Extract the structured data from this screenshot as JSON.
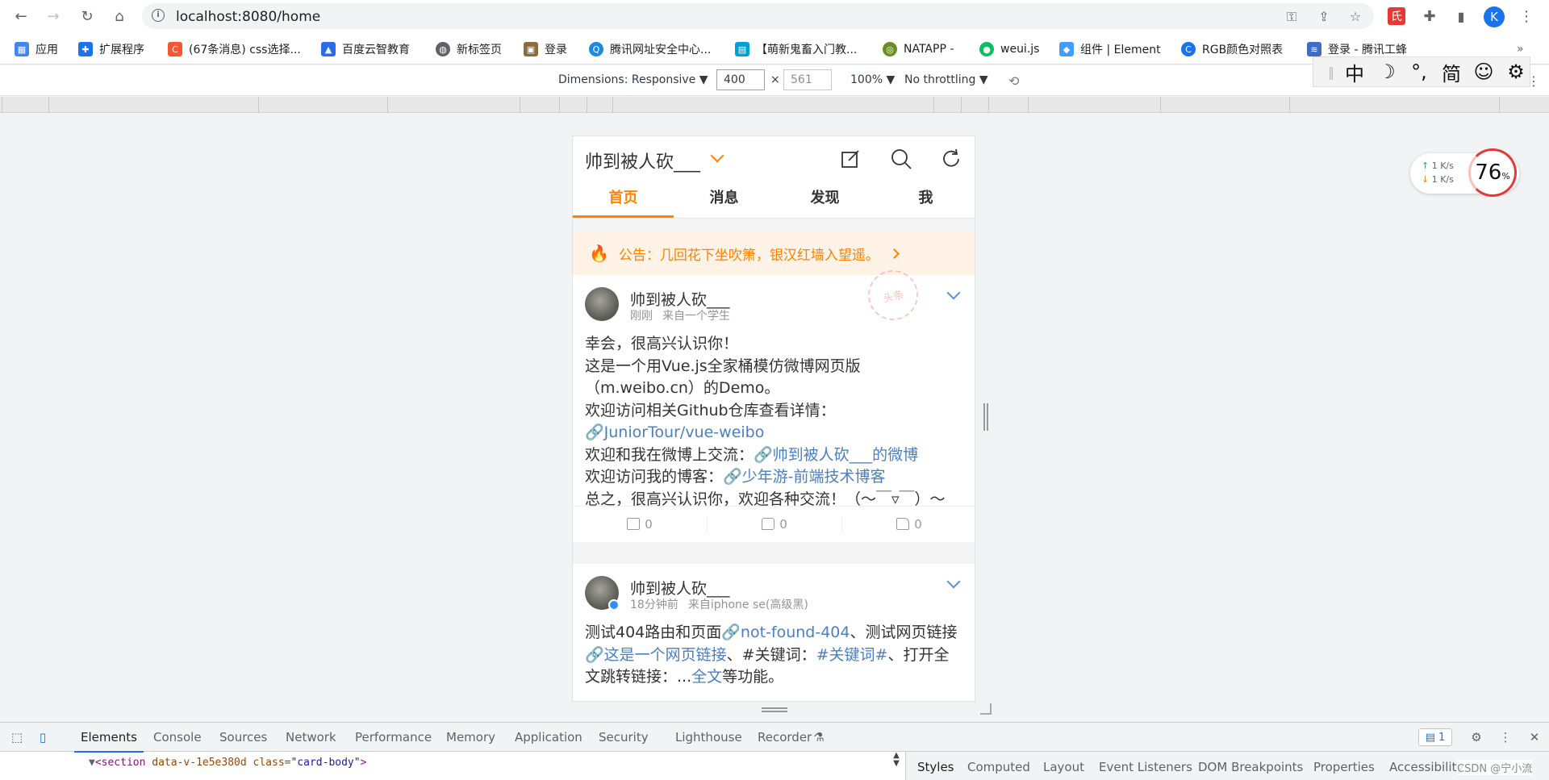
{
  "browser": {
    "url": "localhost:8080/home",
    "profile_initial": "K",
    "bookmarks": [
      {
        "label": "应用",
        "icon": "apps-grid-icon",
        "color": "#4285f4"
      },
      {
        "label": "扩展程序",
        "icon": "puzzle-icon",
        "color": "#1a73e8"
      },
      {
        "label": "(67条消息) css选择...",
        "icon": "csdn-icon",
        "color": "#fc5531"
      },
      {
        "label": "百度云智教育",
        "icon": "graduation-cap-icon",
        "color": "#2b6de5"
      },
      {
        "label": "新标签页",
        "icon": "globe-icon",
        "color": "#5f6368"
      },
      {
        "label": "登录",
        "icon": "picture-icon",
        "color": "#8a6d3b"
      },
      {
        "label": "腾讯网址安全中心...",
        "icon": "tencent-shield-icon",
        "color": "#1e88e5"
      },
      {
        "label": "【萌新鬼畜入门教...",
        "icon": "bilibili-icon",
        "color": "#00a1d6"
      },
      {
        "label": "NATAPP -",
        "icon": "natapp-icon",
        "color": "#6b8e23"
      },
      {
        "label": "weui.js",
        "icon": "wechat-icon",
        "color": "#07c160"
      },
      {
        "label": "组件 | Element",
        "icon": "element-icon",
        "color": "#409eff"
      },
      {
        "label": "RGB颜色对照表",
        "icon": "rgb-icon",
        "color": "#1a73e8"
      },
      {
        "label": "登录 - 腾讯工蜂",
        "icon": "bee-icon",
        "color": "#3e6dc1"
      }
    ]
  },
  "device_toolbar": {
    "dimensions_label": "Dimensions: Responsive ▼",
    "width": "400",
    "height": "561",
    "zoom": "100% ▼",
    "throttling": "No throttling ▼",
    "separator": "×"
  },
  "ime": {
    "lang": "中",
    "punct": "°,",
    "script": "简"
  },
  "speed_widget": {
    "up": "1   K/s",
    "down": "1   K/s",
    "percent": "76",
    "percent_unit": "%"
  },
  "app": {
    "title": "帅到被人砍___",
    "tabs": [
      "首页",
      "消息",
      "发现",
      "我"
    ],
    "notice": "公告：几回花下坐吹箫，银汉红墙入望遥。",
    "posts": [
      {
        "author": "帅到被人砍___",
        "time": "刚刚",
        "source": "来自一个学生",
        "stamp": "头条",
        "lines": [
          {
            "text": "幸会，很高兴认识你！"
          },
          {
            "text": "这是一个用Vue.js全家桶模仿微博网页版"
          },
          {
            "text": "（m.weibo.cn）的Demo。"
          },
          {
            "text": "欢迎访问相关Github仓库查看详情："
          },
          {
            "link": "🔗JuniorTour/vue-weibo"
          },
          {
            "text": "欢迎和我在微博上交流：",
            "link": "🔗帅到被人砍___的微博"
          },
          {
            "text": "欢迎访问我的博客：",
            "link": "🔗少年游-前端技术博客"
          },
          {
            "text": "总之，很高兴认识你，欢迎各种交流！（～￣▿￣）～"
          }
        ],
        "reposts": "0",
        "comments": "0",
        "likes": "0"
      },
      {
        "author": "帅到被人砍___",
        "time": "18分钟前",
        "source": "来自iphone se(高级黑)",
        "verified": true,
        "segments": [
          {
            "t": "测试404路由和页面"
          },
          {
            "l": "🔗not-found-404"
          },
          {
            "t": "、测试网页链接"
          },
          {
            "l": "🔗这是一个网页链接"
          },
          {
            "t": "、#关键词："
          },
          {
            "l": "#关键词#"
          },
          {
            "t": "、打开全文跳转链接：..."
          },
          {
            "l": "全文"
          },
          {
            "t": "等功能。"
          }
        ]
      }
    ]
  },
  "devtools": {
    "tabs": [
      "Elements",
      "Console",
      "Sources",
      "Network",
      "Performance",
      "Memory",
      "Application",
      "Security",
      "Lighthouse",
      "Recorder"
    ],
    "active_tab": "Elements",
    "issues_count": "1",
    "dom_line_tag": "<section",
    "dom_line_attr1": "data-v-1e5e380d",
    "dom_line_attr2": "class=",
    "dom_line_val": "\"card-body\"",
    "dom_line_end": ">",
    "side_tabs": [
      "Styles",
      "Computed",
      "Layout",
      "Event Listeners",
      "DOM Breakpoints",
      "Properties",
      "Accessibility"
    ],
    "active_side_tab": "Styles"
  },
  "watermark": "CSDN @宁小流"
}
